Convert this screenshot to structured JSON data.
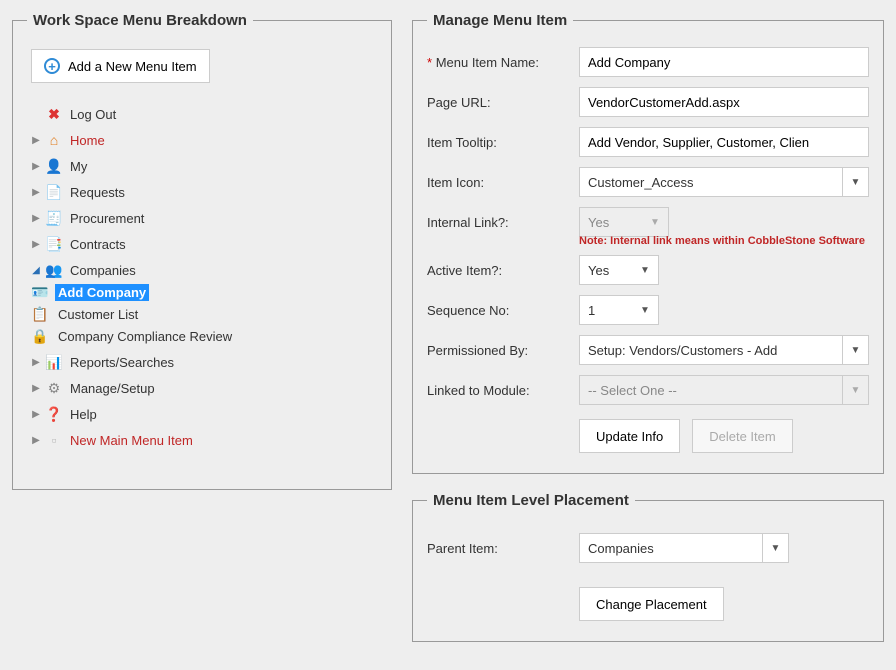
{
  "left": {
    "legend": "Work Space Menu Breakdown",
    "add_btn": "Add a New Menu Item",
    "tree": {
      "logout": "Log Out",
      "home": "Home",
      "my": "My",
      "requests": "Requests",
      "procurement": "Procurement",
      "contracts": "Contracts",
      "companies": "Companies",
      "companies_children": {
        "add_company": "Add Company",
        "customer_list": "Customer List",
        "compliance": "Company Compliance Review"
      },
      "reports": "Reports/Searches",
      "manage": "Manage/Setup",
      "help": "Help",
      "new_main": "New Main Menu Item"
    }
  },
  "manage": {
    "legend": "Manage Menu Item",
    "labels": {
      "name": "Menu Item Name:",
      "url": "Page URL:",
      "tooltip": "Item Tooltip:",
      "icon": "Item Icon:",
      "internal": "Internal Link?:",
      "active": "Active Item?:",
      "seq": "Sequence No:",
      "perm": "Permissioned By:",
      "module": "Linked to Module:"
    },
    "values": {
      "name": "Add Company",
      "url": "VendorCustomerAdd.aspx",
      "tooltip": "Add Vendor, Supplier, Customer, Clien",
      "icon": "Customer_Access",
      "internal": "Yes",
      "active": "Yes",
      "seq": "1",
      "perm": "Setup: Vendors/Customers - Add",
      "module": "-- Select One --"
    },
    "note": "Note: Internal link means within CobbleStone Software",
    "buttons": {
      "update": "Update Info",
      "delete": "Delete Item"
    }
  },
  "placement": {
    "legend": "Menu Item Level Placement",
    "label": "Parent Item:",
    "value": "Companies",
    "button": "Change Placement"
  }
}
